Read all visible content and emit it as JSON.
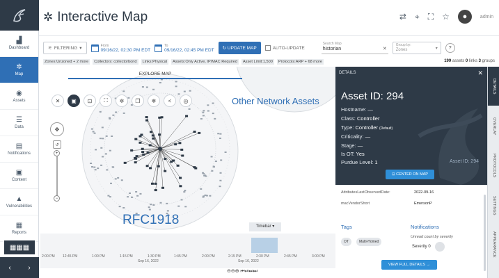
{
  "header": {
    "title": "Interactive Map",
    "admin_label": "admin"
  },
  "sidebar": {
    "items": [
      {
        "label": "Dashboard",
        "icon": "dashboard-icon"
      },
      {
        "label": "Map",
        "icon": "map-icon",
        "active": true
      },
      {
        "label": "Assets",
        "icon": "assets-icon"
      },
      {
        "label": "Data",
        "icon": "data-icon"
      },
      {
        "label": "Notifications",
        "icon": "bell-icon"
      },
      {
        "label": "Content",
        "icon": "content-icon"
      },
      {
        "label": "Vulnerabilities",
        "icon": "warning-icon"
      },
      {
        "label": "Reports",
        "icon": "reports-icon"
      }
    ]
  },
  "toolbar": {
    "filter_label": "FILTERING",
    "from_label": "From",
    "from_value": "09/16/22, 02:30 PM EDT",
    "to_label": "To",
    "to_value": "09/16/22, 02:45 PM EDT",
    "update_label": "UPDATE MAP",
    "auto_update_label": "AUTO-UPDATE",
    "search_label": "Search Map",
    "search_value": "historian",
    "group_label": "Group by:",
    "group_value": "Zones"
  },
  "chips": [
    "Zones:Unzoned + 2 more",
    "Collectors: collectorbond",
    "Links:Physical",
    "Assets:Only Active, IP/MAC Required",
    "Asset Limit:1,500",
    "Protocols:ARP + 68 more"
  ],
  "counts": {
    "assets": "199",
    "assets_label": "assets",
    "links": "0",
    "links_label": "links",
    "groups": "3",
    "groups_label": "groups"
  },
  "map": {
    "explore_tab": "EXPLORE MAP",
    "other_label": "Other Network Assets",
    "rfc_label": "RFC1918",
    "timebar_label": "Timebar ▾",
    "ticks": [
      "2:00 PM",
      "12:45 PM",
      "1:00 PM",
      "1:15 PM",
      "1:30 PM",
      "1:45 PM",
      "2:00 PM",
      "2:15 PM",
      "2:30 PM",
      "2:45 PM",
      "3:00 PM"
    ],
    "date_left": "Sep 16, 2022",
    "date_right": "Sep 16, 2022",
    "play_controls": "⊖⊖⊕   ⏮⏯⏭⏭"
  },
  "details": {
    "header": "DETAILS",
    "title": "Asset ID: 294",
    "fields": [
      {
        "label": "Hostname:",
        "value": "—"
      },
      {
        "label": "Class:",
        "value": "Controller"
      },
      {
        "label": "Type:",
        "value": "Controller",
        "extra": "(Default)"
      },
      {
        "label": "Criticality:",
        "value": "—"
      },
      {
        "label": "Stage:",
        "value": "—"
      },
      {
        "label": "Is OT:",
        "value": "Yes"
      },
      {
        "label": "Purdue Level:",
        "value": "1"
      }
    ],
    "asset_id_right": "Asset ID: 294",
    "center_btn": "CENTER ON MAP",
    "attributes": [
      {
        "key": "AttributesLastObservedDate:",
        "value": "2022-09-16"
      },
      {
        "key": "macVendorShort",
        "value": "EmersonP"
      }
    ],
    "tags_title": "Tags",
    "tags": [
      "OT",
      "Multi-Homed"
    ],
    "notif_title": "Notifications",
    "notif_sub": "Unread count by severity",
    "severity_label": "Severity 0",
    "view_btn": "VIEW FULL DETAILS"
  },
  "vtabs": [
    "DETAILS",
    "OVERLAY",
    "PROTOCOLS",
    "SETTINGS",
    "APPEARANCE"
  ],
  "colors": {
    "accent": "#2f6fb5",
    "dark": "#2e3a47",
    "button": "#2f8fd8"
  }
}
